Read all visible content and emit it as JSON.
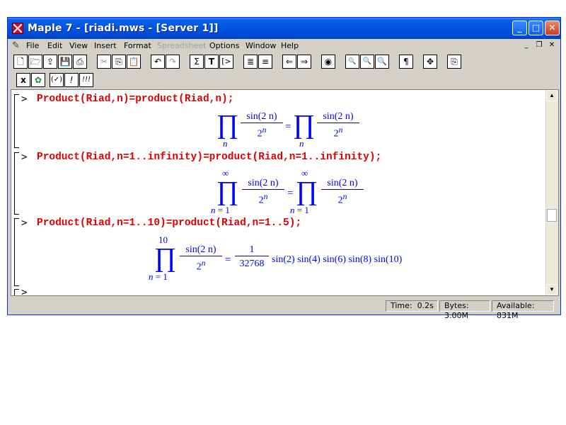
{
  "window": {
    "title": "Maple 7  - [riadi.mws - [Server 1]]",
    "controls": {
      "minimize": "_",
      "maximize": "□",
      "close": "✕"
    }
  },
  "menu": {
    "items": [
      "File",
      "Edit",
      "View",
      "Insert",
      "Format",
      "Spreadsheet",
      "Options",
      "Window",
      "Help"
    ],
    "disabled": [
      "Spreadsheet"
    ],
    "mdi_controls": {
      "minimize": "_",
      "restore": "❐",
      "close": "✕"
    }
  },
  "toolbar1": {
    "buttons": [
      {
        "icon": "new-icon",
        "glyph": "🗋"
      },
      {
        "icon": "open-icon",
        "glyph": "🗁"
      },
      {
        "icon": "open-url-icon",
        "glyph": "⇪"
      },
      {
        "icon": "save-icon",
        "glyph": "💾"
      },
      {
        "icon": "print-icon",
        "glyph": "⎙"
      },
      {
        "icon": "cut-icon",
        "glyph": "✂"
      },
      {
        "icon": "copy-icon",
        "glyph": "⎘"
      },
      {
        "icon": "paste-icon",
        "glyph": "📋"
      },
      {
        "icon": "undo-icon",
        "glyph": "↶"
      },
      {
        "icon": "redo-icon",
        "glyph": "↷"
      },
      {
        "icon": "sigma-icon",
        "glyph": "Σ"
      },
      {
        "icon": "text-icon",
        "glyph": "T"
      },
      {
        "icon": "prompt-icon",
        "glyph": "[>"
      },
      {
        "icon": "group-icon",
        "glyph": "≣"
      },
      {
        "icon": "ungroup-icon",
        "glyph": "≡"
      },
      {
        "icon": "back-icon",
        "glyph": "⇐"
      },
      {
        "icon": "forward-icon",
        "glyph": "⇒"
      },
      {
        "icon": "stop-icon",
        "glyph": "◉"
      },
      {
        "icon": "zoom-small-icon",
        "glyph": "🔍"
      },
      {
        "icon": "zoom-medium-icon",
        "glyph": "🔍"
      },
      {
        "icon": "zoom-large-icon",
        "glyph": "🔍"
      },
      {
        "icon": "pilcrow-icon",
        "glyph": "¶"
      },
      {
        "icon": "move-icon",
        "glyph": "✥"
      },
      {
        "icon": "restart-icon",
        "glyph": "⎘"
      }
    ]
  },
  "toolbar2": {
    "buttons": [
      {
        "icon": "math-mode-icon",
        "glyph": "x"
      },
      {
        "icon": "maple-leaf-icon",
        "glyph": "✿"
      },
      {
        "icon": "check-syntax-icon",
        "glyph": "(✓)"
      },
      {
        "icon": "execute-icon",
        "glyph": "!"
      },
      {
        "icon": "execute-all-icon",
        "glyph": "!!!"
      }
    ]
  },
  "worksheet": {
    "prompt": ">",
    "commands": [
      "Product(Riad,n)=product(Riad,n);",
      "Product(Riad,n=1..infinity)=product(Riad,n=1..infinity);",
      "Product(Riad,n=1..10)=product(Riad,n=1..5);"
    ],
    "outputs": {
      "o1": {
        "pi": "∏",
        "num": "sin(2 n)",
        "den": "2",
        "exp": "n",
        "sub": "n",
        "eq": "="
      },
      "o2": {
        "pi": "∏",
        "num": "sin(2 n)",
        "den": "2",
        "exp": "n",
        "sub": "n = 1",
        "sup": "∞",
        "eq": "="
      },
      "o3": {
        "pi": "∏",
        "num": "sin(2 n)",
        "den": "2",
        "exp": "n",
        "sub": "n = 1",
        "sup": "10",
        "eq": "=",
        "rhs_num": "1",
        "rhs_den": "32768",
        "rhs_tail": "sin(2) sin(4) sin(6) sin(8) sin(10)"
      }
    }
  },
  "status": {
    "time_label": "Time:",
    "time_value": "0.2s",
    "bytes": "Bytes: 3.00M",
    "available": "Available: 831M"
  }
}
